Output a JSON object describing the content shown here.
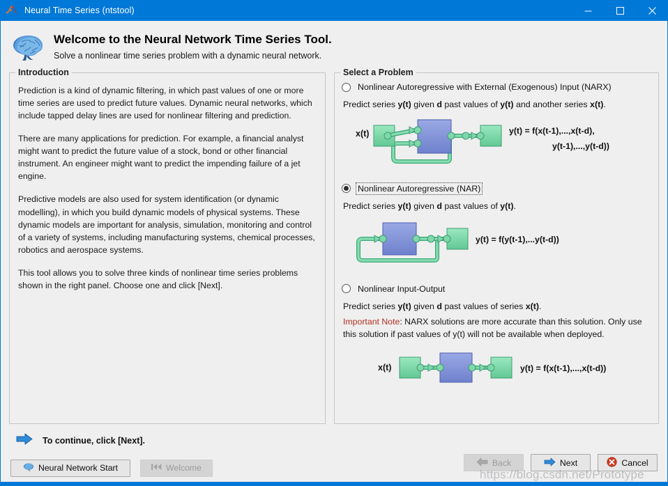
{
  "window": {
    "title": "Neural Time Series (ntstool)",
    "app_icon": "matlab-membrane-icon",
    "minimize_label": "─",
    "maximize_label": "□",
    "close_label": "×",
    "titlebar_color": "#0078d7"
  },
  "header": {
    "icon": "brain-icon",
    "title": "Welcome to the Neural Network Time Series Tool.",
    "subtitle": "Solve a nonlinear time series problem with a dynamic neural network."
  },
  "introduction": {
    "title": "Introduction",
    "paragraphs": [
      "Prediction is a kind of dynamic filtering, in which past values of one or more time series are used to predict future values. Dynamic neural networks, which include tapped delay lines are used for nonlinear filtering and prediction.",
      "There are many applications for prediction. For example, a financial analyst might want to predict the future value of a stock, bond or other financial instrument. An engineer might want to predict the impending failure of a jet engine.",
      "Predictive models are also used for system identification (or dynamic modelling), in which you build dynamic models of physical systems. These dynamic models are important for analysis, simulation, monitoring and control of a variety of systems, including manufacturing systems, chemical processes, robotics and aerospace systems.",
      "This tool allows you to solve three kinds of nonlinear time series problems shown in the right panel. Choose one and click [Next]."
    ]
  },
  "select_problem": {
    "title": "Select a Problem",
    "options": [
      {
        "id": "narx",
        "label": "Nonlinear Autoregressive with External (Exogenous) Input (NARX)",
        "selected": false,
        "focused": false,
        "description_parts": [
          "Predict series ",
          "y(t)",
          " given ",
          "d",
          " past values of ",
          "y(t)",
          " and another series ",
          "x(t)",
          "."
        ],
        "diagram": {
          "type": "narx",
          "input_label": "x(t)",
          "equation_line1": "y(t) = f(x(t-1),...,x(t-d),",
          "equation_line2": "y(t-1),...,y(t-d))",
          "has_feedback": true,
          "has_external_input": true
        }
      },
      {
        "id": "nar",
        "label": "Nonlinear Autoregressive (NAR)",
        "selected": true,
        "focused": true,
        "description_parts": [
          "Predict series ",
          "y(t)",
          " given ",
          "d",
          " past values of ",
          "y(t)",
          "."
        ],
        "diagram": {
          "type": "nar",
          "input_label": "",
          "equation_line1": "y(t) = f(y(t-1),...y(t-d))",
          "equation_line2": "",
          "has_feedback": true,
          "has_external_input": false
        }
      },
      {
        "id": "nio",
        "label": "Nonlinear Input-Output",
        "selected": false,
        "focused": false,
        "description_parts": [
          "Predict series ",
          "y(t)",
          " given ",
          "d",
          " past values of series ",
          "x(t)",
          "."
        ],
        "note_label": "Important Note",
        "note_text": ": NARX solutions are more accurate than this solution. Only use this solution if past values of y(t) will not be available when deployed.",
        "diagram": {
          "type": "nio",
          "input_label": "x(t)",
          "equation_line1": "y(t) = f(x(t-1),...,x(t-d))",
          "equation_line2": "",
          "has_feedback": false,
          "has_external_input": true
        }
      }
    ]
  },
  "footer": {
    "continue_icon": "blue-right-arrow-icon",
    "continue_text": "To continue, click [Next].",
    "neural_network_start": {
      "label": "Neural Network Start",
      "icon": "brain-icon",
      "disabled": false
    },
    "welcome": {
      "label": "Welcome",
      "icon": "rewind-icon",
      "disabled": true
    },
    "back": {
      "label": "Back",
      "icon": "left-arrow-icon",
      "disabled": true
    },
    "next": {
      "label": "Next",
      "icon": "right-arrow-icon",
      "disabled": false
    },
    "cancel": {
      "label": "Cancel",
      "icon": "cancel-icon",
      "disabled": false
    }
  },
  "watermark": {
    "text": "https://blog.csdn.net/Prototype"
  },
  "colors": {
    "accent": "#0078d7",
    "block_green": "#7fd9a8",
    "block_blue": "#8292d9",
    "note_red": "#b03020",
    "panel_bg": "#efefef"
  }
}
